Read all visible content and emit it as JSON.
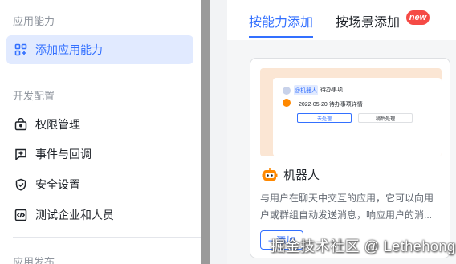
{
  "sidebar": {
    "section_ability": "应用能力",
    "add_ability": "添加应用能力",
    "section_dev": "开发配置",
    "items": [
      {
        "label": "权限管理",
        "icon": "permission-icon"
      },
      {
        "label": "事件与回调",
        "icon": "event-icon"
      },
      {
        "label": "安全设置",
        "icon": "shield-icon"
      },
      {
        "label": "测试企业和人员",
        "icon": "code-icon"
      }
    ],
    "section_publish": "应用发布"
  },
  "tabs": {
    "by_ability": "按能力添加",
    "by_scene": "按场景添加",
    "badge": "new"
  },
  "card": {
    "preview": {
      "tag": "@机器人",
      "header": "待办事项",
      "line": "2022-05-20 待办事项详情",
      "button_primary": "去处理",
      "button_secondary": "稍后处理"
    },
    "title": "机器人",
    "description": "与用户在聊天中交互的应用，它可以向用户或群组自动发送消息，响应用户的消...",
    "add_button": "+ 添加"
  },
  "watermark": "掘金技术社区 @ Lethehong",
  "colors": {
    "accent": "#3370ff",
    "active_bg": "#e1eaff",
    "badge": "#f54a45",
    "preview_bg": "#fbe6d4",
    "bot_icon": "#ff8800"
  }
}
